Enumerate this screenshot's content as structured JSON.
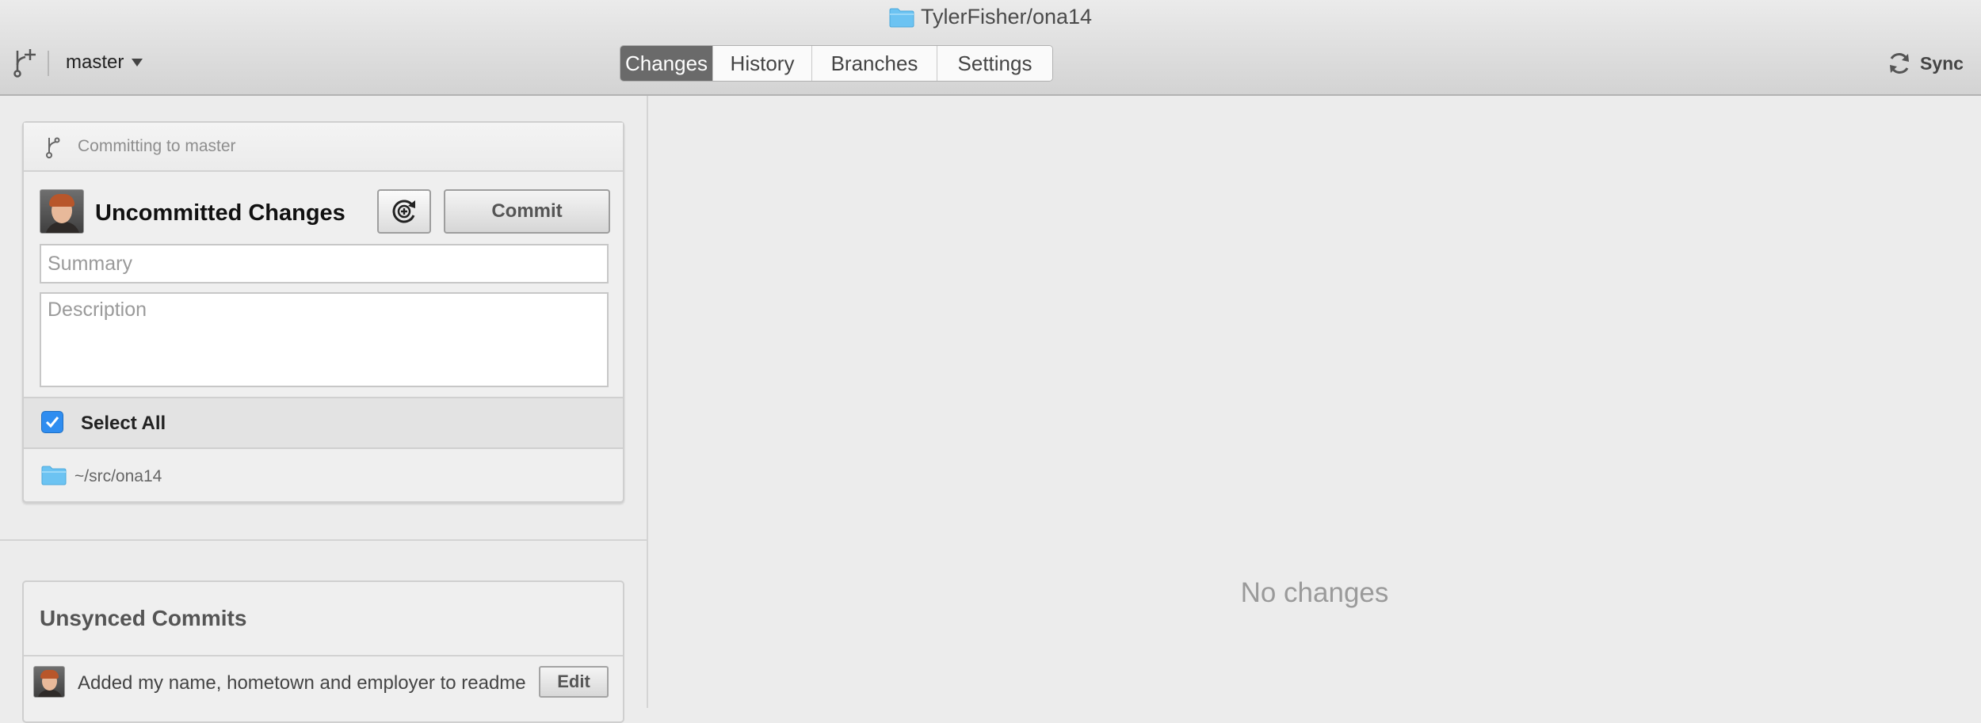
{
  "window": {
    "title": "TylerFisher/ona14"
  },
  "toolbar": {
    "branch": "master",
    "tabs": [
      {
        "label": "Changes",
        "active": true
      },
      {
        "label": "History",
        "active": false
      },
      {
        "label": "Branches",
        "active": false
      },
      {
        "label": "Settings",
        "active": false
      }
    ],
    "sync_label": "Sync"
  },
  "commit_panel": {
    "committing_label": "Committing to master",
    "title": "Uncommitted Changes",
    "commit_button": "Commit",
    "summary_placeholder": "Summary",
    "description_placeholder": "Description",
    "select_all_label": "Select All",
    "select_all_checked": true,
    "repo_path": "~/src/ona14"
  },
  "unsynced": {
    "title": "Unsynced Commits",
    "commits": [
      {
        "message": "Added my name, hometown and employer to readme",
        "edit_label": "Edit"
      }
    ]
  },
  "main": {
    "empty_message": "No changes"
  },
  "colors": {
    "accent_blue": "#2f8df0",
    "active_tab": "#6a6a6a",
    "folder_blue": "#6cc3f2"
  },
  "icons": [
    "folder-icon",
    "add-branch-icon",
    "branch-icon",
    "sync-icon",
    "discard-icon",
    "checkmark-icon"
  ]
}
